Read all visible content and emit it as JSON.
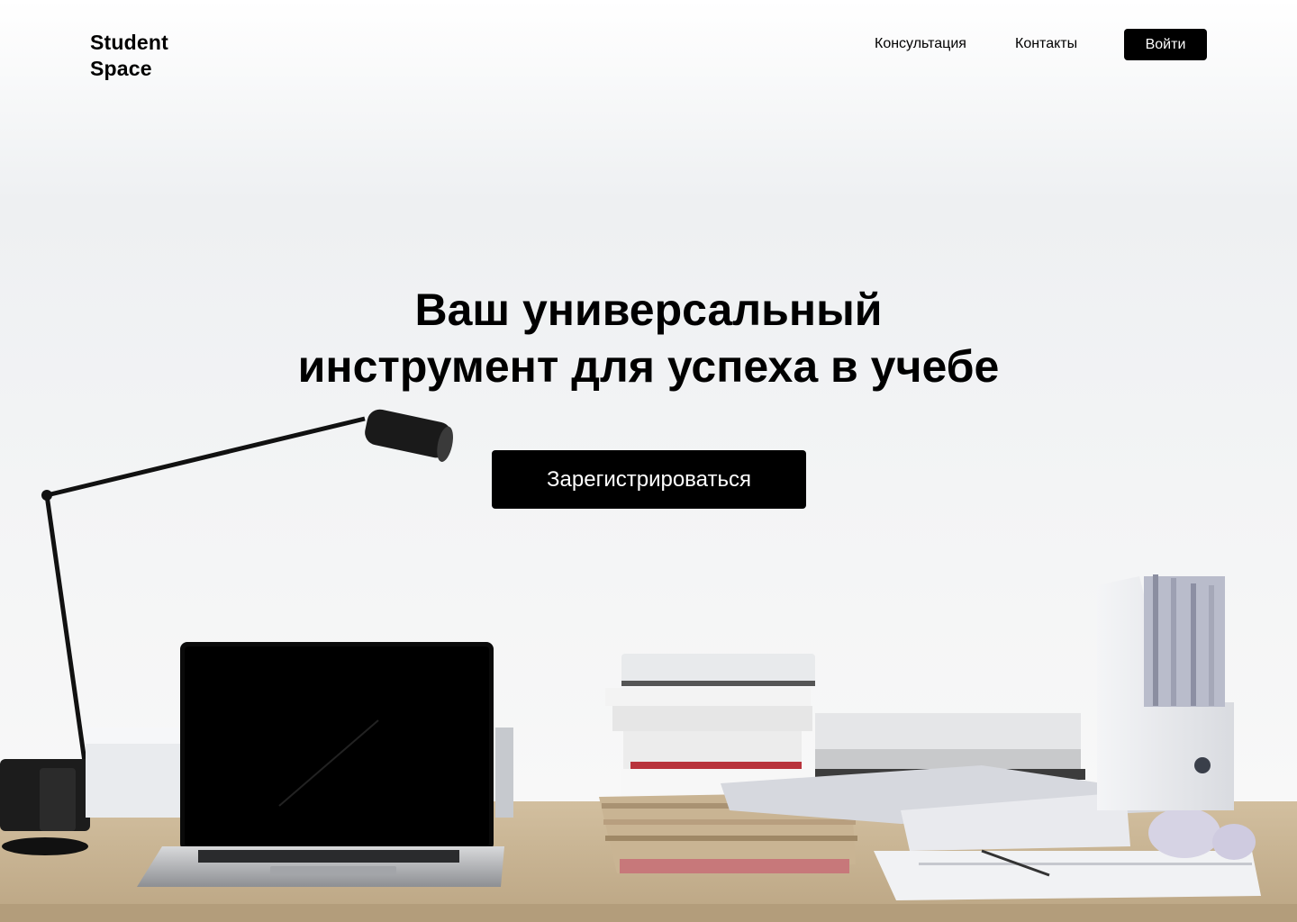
{
  "header": {
    "logo_line1": "Student",
    "logo_line2": "Space",
    "nav": [
      {
        "label": "Консультация"
      },
      {
        "label": "Контакты"
      }
    ],
    "login_label": "Войти"
  },
  "hero": {
    "title_line1": "Ваш универсальный",
    "title_line2": "инструмент для успеха в учебе",
    "cta_label": "Зарегистрироваться"
  },
  "colors": {
    "accent": "#000000",
    "button_text": "#ffffff",
    "desk": "#c8b393",
    "background": "#f3f4f6"
  },
  "background_image": "desk-workspace-photo"
}
